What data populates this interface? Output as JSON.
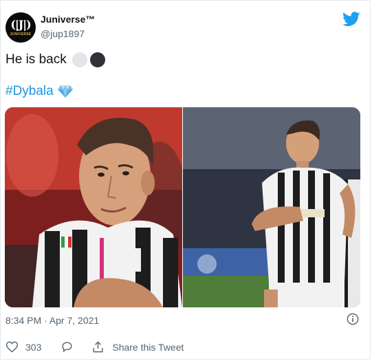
{
  "author": {
    "name": "Juniverse™",
    "handle": "@jup1897",
    "avatar_text": "JUNIVERSE",
    "avatar_icon": "juventus-j-logo"
  },
  "tweet": {
    "text": "He is back",
    "emojis": [
      "white-circle",
      "black-circle"
    ],
    "hashtag": "#Dybala",
    "hashtag_emoji": "gem-stone"
  },
  "media": {
    "photos": [
      {
        "icon": "player-photo-closeup",
        "description_colors": [
          "#b62a2a",
          "#1f1f1f",
          "#f2f2f2"
        ]
      },
      {
        "icon": "player-photo-celebration",
        "description_colors": [
          "#3a4152",
          "#4f7d3a",
          "#f2f2f2"
        ]
      }
    ]
  },
  "timestamp": "8:34 PM · Apr 7, 2021",
  "actions": {
    "likes": "303",
    "share_label": "Share this Tweet"
  },
  "colors": {
    "accent": "#1b95e0",
    "twitter_blue": "#1da1f2",
    "muted": "#536471"
  }
}
